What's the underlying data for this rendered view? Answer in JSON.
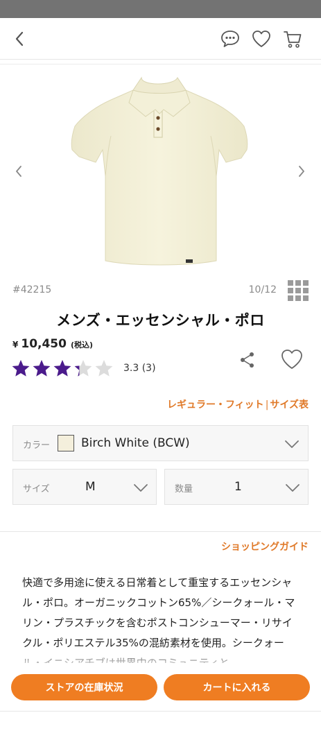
{
  "header": {
    "back_icon": "chevron-left-icon",
    "chat_icon": "chat-bubble-icon",
    "favorites_icon": "heart-icon",
    "cart_icon": "cart-icon"
  },
  "gallery": {
    "prev_icon": "chevron-left-icon",
    "next_icon": "chevron-right-icon",
    "image_subject": "polo-shirt",
    "sku": "#42215",
    "counter": "10/12",
    "grid_icon": "grid-icon"
  },
  "product": {
    "title": "メンズ・エッセンシャル・ポロ",
    "currency": "¥",
    "price": "10,450",
    "tax_note": "(税込)",
    "rating": 3.3,
    "rating_text": "3.3 (3)",
    "star_color": "#4b1b8c"
  },
  "links": {
    "fit": "レギュラー・フィット",
    "separator": "|",
    "size_chart": "サイズ表"
  },
  "options": {
    "color_label": "カラー",
    "color_value": "Birch White (BCW)",
    "swatch_color": "#f4efdc",
    "size_label": "サイズ",
    "size_value": "M",
    "qty_label": "数量",
    "qty_value": "1"
  },
  "guide": {
    "label": "ショッピングガイド"
  },
  "description": {
    "text": "快適で多用途に使える日常着として重宝するエッセンシャル・ポロ。オーガニックコットン65%／シークォール・マリン・プラスチックを含むポストコンシューマー・リサイクル・ポリエステル35%の混紡素材を使用。シークォール・イニシアチブは世界中のコミュニティと"
  },
  "actions": {
    "store_stock": "ストアの在庫状況",
    "add_to_cart": "カートに入れる",
    "accent_color": "#ef7d22"
  }
}
